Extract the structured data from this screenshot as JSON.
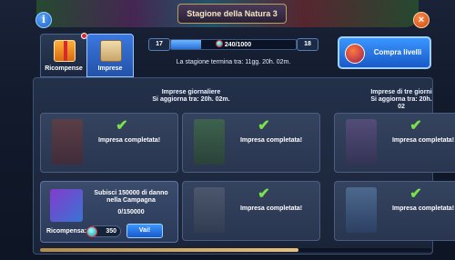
{
  "header": {
    "title": "Stagione della Natura 3",
    "info_icon": "i",
    "close_icon": "×"
  },
  "tabs": [
    {
      "label": "Ricompense",
      "icon": "gift-icon",
      "badge": true
    },
    {
      "label": "Imprese",
      "icon": "scroll-icon",
      "selected": true
    }
  ],
  "season": {
    "level_current": "17",
    "level_next": "18",
    "progress_text": "240/1000",
    "progress_fraction": 0.24,
    "end_text": "La stagione termina tra: 11gg. 20h. 02m."
  },
  "buy_levels": {
    "label": "Compra livelli"
  },
  "columns": {
    "daily_title": "Imprese giornaliere",
    "daily_refresh": "Si aggiorna tra: 20h. 02m.",
    "three_day_title": "Imprese di tre giorni",
    "three_day_refresh": "Si aggiorna tra: 20h. 02"
  },
  "completed_label": "Impresa completata!",
  "check_icon": "✔",
  "active_task": {
    "title": "Subisci 150000 di danno nella Campagna",
    "progress": "0/150000",
    "reward_label": "Ricompensa:",
    "reward_value": "350",
    "go_label": "Vai!"
  },
  "colors": {
    "accent": "#2670d8",
    "check": "#7be04a",
    "gold": "#e8c27a"
  }
}
